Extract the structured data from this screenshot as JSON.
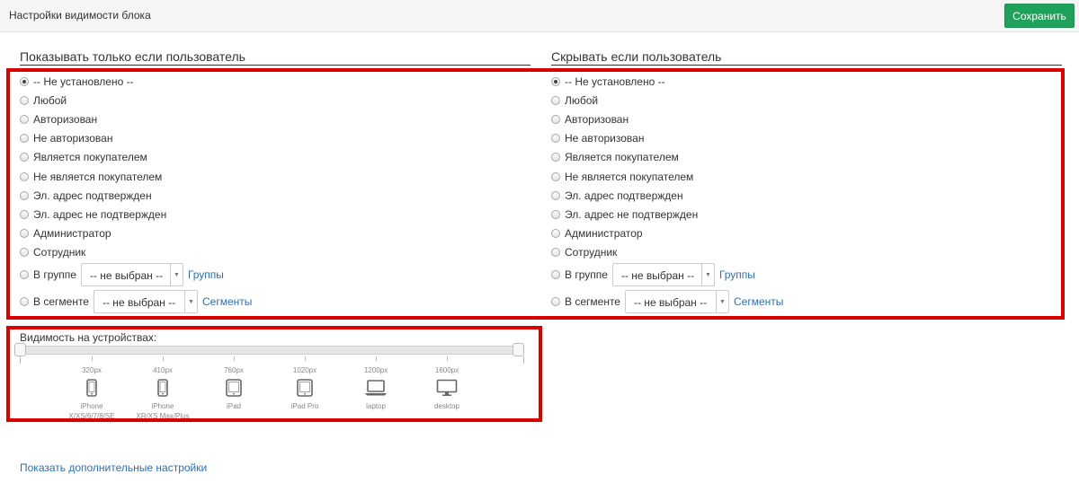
{
  "header": {
    "title": "Настройки видимости блока",
    "save_label": "Сохранить"
  },
  "show_section": {
    "title": "Показывать только если пользователь",
    "options": [
      "-- Не установлено --",
      "Любой",
      "Авторизован",
      "Не авторизован",
      "Является покупателем",
      "Не является покупателем",
      "Эл. адрес подтвержден",
      "Эл. адрес не подтвержден",
      "Администратор",
      "Сотрудник"
    ],
    "selected_index": 0,
    "group_label": "В группе",
    "group_select": "-- не выбран --",
    "group_link": "Группы",
    "segment_label": "В сегменте",
    "segment_select": "-- не выбран --",
    "segment_link": "Сегменты"
  },
  "hide_section": {
    "title": "Скрывать если пользователь",
    "options": [
      "-- Не установлено --",
      "Любой",
      "Авторизован",
      "Не авторизован",
      "Является покупателем",
      "Не является покупателем",
      "Эл. адрес подтвержден",
      "Эл. адрес не подтвержден",
      "Администратор",
      "Сотрудник"
    ],
    "selected_index": 0,
    "group_label": "В группе",
    "group_select": "-- не выбран --",
    "group_link": "Группы",
    "segment_label": "В сегменте",
    "segment_select": "-- не выбран --",
    "segment_link": "Сегменты"
  },
  "devices": {
    "label": "Видимость на устройствах:",
    "items": [
      {
        "px": "320px",
        "name": "iPhone",
        "sub": "X/XS/6/7/8/SE",
        "icon": "phone-icon"
      },
      {
        "px": "410px",
        "name": "iPhone",
        "sub": "XR/XS Max/Plus",
        "icon": "phone-icon"
      },
      {
        "px": "760px",
        "name": "iPad",
        "sub": "",
        "icon": "tablet-icon"
      },
      {
        "px": "1020px",
        "name": "iPad Pro",
        "sub": "",
        "icon": "tablet-icon"
      },
      {
        "px": "1200px",
        "name": "laptop",
        "sub": "",
        "icon": "laptop-icon"
      },
      {
        "px": "1600px",
        "name": "desktop",
        "sub": "",
        "icon": "desktop-icon"
      }
    ],
    "range": [
      0,
      1
    ]
  },
  "footer": {
    "more_link": "Показать дополнительные настройки"
  },
  "colors": {
    "accent_green": "#1fa05b",
    "highlight_red": "#d90000",
    "link_blue": "#2d6fb3"
  }
}
